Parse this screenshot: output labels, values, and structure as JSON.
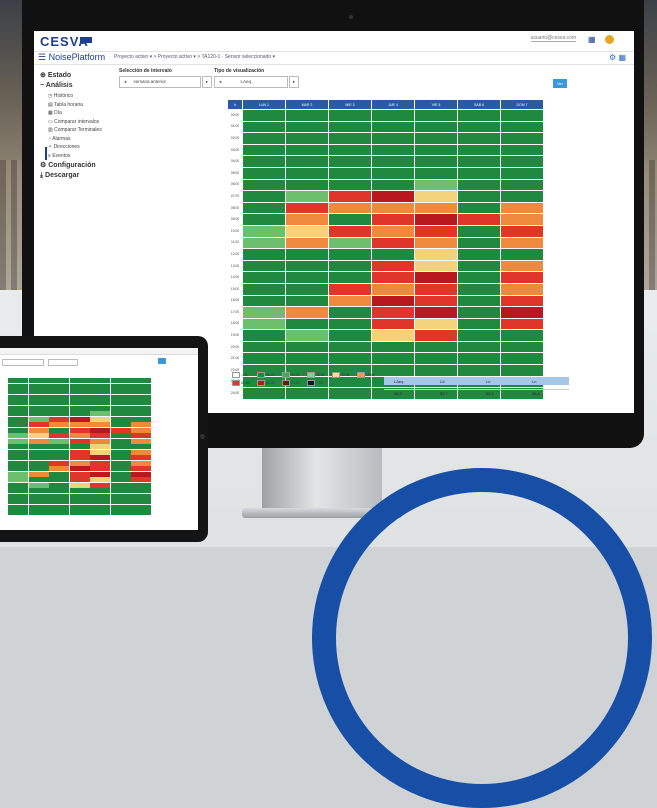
{
  "app": {
    "logo": "CESVA",
    "brand": "NoisePlatform",
    "user_label": "usuario@cesva.com",
    "breadcrumb": "Proyecto activo ▾  >  Proyecto activo ▾  >  TA120-1 · Sensor seleccionado ▾"
  },
  "sidebar": {
    "items": [
      {
        "label": "Estado",
        "kind": "main",
        "icon": "plus-icon"
      },
      {
        "label": "Análisis",
        "kind": "main",
        "icon": "minus-icon"
      },
      {
        "label": "Histórico",
        "kind": "sub",
        "icon": "clock-icon"
      },
      {
        "label": "Tabla horaria",
        "kind": "sub",
        "icon": "table-icon"
      },
      {
        "label": "Día",
        "kind": "sub",
        "icon": "calendar-icon"
      },
      {
        "label": "Comparar intervalos",
        "kind": "sub",
        "icon": "document-icon"
      },
      {
        "label": "Comparar Terminales",
        "kind": "sub",
        "icon": "chart-icon"
      },
      {
        "label": "Alarmas",
        "kind": "sub",
        "icon": "bell-icon"
      },
      {
        "label": "Direcciones",
        "kind": "sub",
        "icon": "wind-icon"
      },
      {
        "label": "Eventos",
        "kind": "sub",
        "icon": "list-icon"
      },
      {
        "label": "Configuración",
        "kind": "main",
        "icon": "gear-icon"
      },
      {
        "label": "Descargar",
        "kind": "main",
        "icon": "download-icon"
      }
    ]
  },
  "filters": {
    "period_label": "Selección de intervalo",
    "period_value": "semana anterior",
    "type_label": "Tipo de visualización",
    "type_value": "LAeq",
    "go_label": "Ver"
  },
  "table": {
    "headers": [
      "h",
      "LUN 1",
      "MAR 2",
      "MIE 3",
      "JUE 4",
      "VIE 5",
      "SAB 6",
      "DOM 7"
    ],
    "times": [
      "00:00",
      "01:00",
      "02:00",
      "03:00",
      "04:00",
      "05:00",
      "06:00",
      "07:00",
      "08:00",
      "09:00",
      "10:00",
      "11:00",
      "12:00",
      "13:00",
      "14:00",
      "15:00",
      "16:00",
      "17:00",
      "18:00",
      "19:00",
      "20:00",
      "21:00",
      "22:00",
      "23:00",
      "24:00"
    ],
    "cells": [
      [
        "g",
        "g",
        "g",
        "g",
        "g",
        "g",
        "g"
      ],
      [
        "g",
        "g",
        "g",
        "g",
        "g",
        "g",
        "g"
      ],
      [
        "g",
        "g",
        "g",
        "g",
        "g",
        "g",
        "g"
      ],
      [
        "g",
        "g",
        "g",
        "g",
        "g",
        "g",
        "g"
      ],
      [
        "g",
        "g",
        "g",
        "g",
        "g",
        "g",
        "g"
      ],
      [
        "g",
        "g",
        "g",
        "g",
        "g",
        "g",
        "g"
      ],
      [
        "g",
        "g",
        "g",
        "g",
        "lg",
        "g",
        "g"
      ],
      [
        "g",
        "lg",
        "r",
        "dr",
        "y",
        "g",
        "g"
      ],
      [
        "g",
        "r",
        "o",
        "o",
        "o",
        "g",
        "o"
      ],
      [
        "g",
        "o",
        "g",
        "r",
        "dr",
        "r",
        "o"
      ],
      [
        "lg",
        "y",
        "r",
        "o",
        "r",
        "g",
        "r"
      ],
      [
        "lg",
        "o",
        "lg",
        "r",
        "o",
        "g",
        "o"
      ],
      [
        "g",
        "g",
        "g",
        "g",
        "y",
        "g",
        "g"
      ],
      [
        "g",
        "g",
        "g",
        "r",
        "y",
        "g",
        "o"
      ],
      [
        "g",
        "g",
        "g",
        "r",
        "dr",
        "g",
        "r"
      ],
      [
        "g",
        "g",
        "r",
        "o",
        "r",
        "g",
        "o"
      ],
      [
        "g",
        "g",
        "o",
        "dr",
        "r",
        "g",
        "r"
      ],
      [
        "lg",
        "o",
        "g",
        "r",
        "dr",
        "g",
        "dr"
      ],
      [
        "lg",
        "g",
        "g",
        "r",
        "y",
        "g",
        "r"
      ],
      [
        "g",
        "lg",
        "g",
        "y",
        "r",
        "g",
        "g"
      ],
      [
        "g",
        "g",
        "g",
        "g",
        "g",
        "g",
        "g"
      ],
      [
        "g",
        "g",
        "g",
        "g",
        "g",
        "g",
        "g"
      ],
      [
        "g",
        "g",
        "g",
        "g",
        "g",
        "g",
        "g"
      ],
      [
        "g",
        "g",
        "g",
        "g",
        "g",
        "g",
        "g"
      ],
      [
        "g",
        "g",
        "g",
        "g",
        "g",
        "g",
        "g"
      ]
    ]
  },
  "legend": [
    {
      "label": "< 35",
      "color": "#ffffff"
    },
    {
      "label": "35-40",
      "color": "#1e8a3e"
    },
    {
      "label": "40-45",
      "color": "#48a85a"
    },
    {
      "label": "45-50",
      "color": "#8ccf8c"
    },
    {
      "label": "50-55",
      "color": "#f4e38a"
    },
    {
      "label": "55-60",
      "color": "#f0a040"
    },
    {
      "label": "60-65",
      "color": "#e2362a"
    },
    {
      "label": "65-70",
      "color": "#b11a1e"
    },
    {
      "label": "70-75",
      "color": "#6e1215"
    },
    {
      "label": "> 75",
      "color": "#2a0a2a"
    }
  ],
  "summary": {
    "head": [
      "LAeq",
      "Ld",
      "Le",
      "Ln"
    ],
    "values": [
      "56.6",
      "55.7",
      "58.1",
      "58.6"
    ],
    "caption": "Total"
  },
  "colors": {
    "g": "#1f8a3f",
    "lg": "#6cbf6c",
    "y": "#f2d27a",
    "o": "#ef8a3c",
    "r": "#e0352a",
    "dr": "#b8191f",
    "header": "#2c5aa0",
    "brand": "#1c3f8f"
  }
}
